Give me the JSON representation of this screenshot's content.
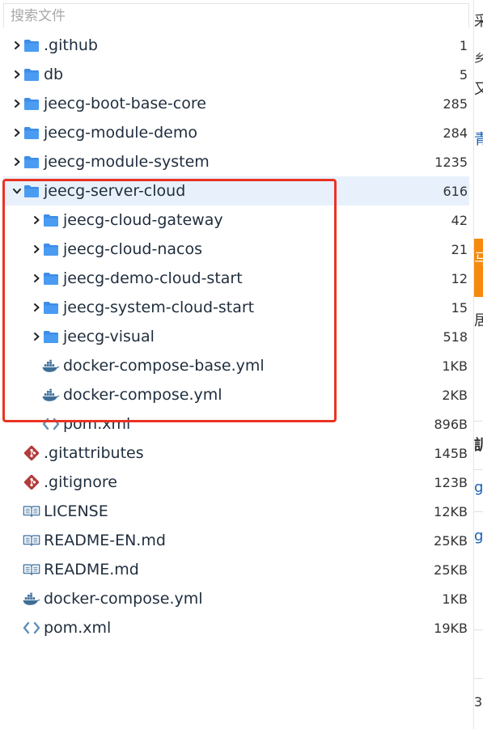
{
  "search": {
    "placeholder": "搜索文件"
  },
  "colors": {
    "folder": "#4a9cf2",
    "git": "#b23b3b",
    "docker": "#3f6f98",
    "xml": "#5f8eb5",
    "book": "#4a7aa8",
    "highlight": "#ea3323",
    "selected_bg": "#e8f1fb"
  },
  "tree": [
    {
      "name": ".github",
      "size": "1",
      "type": "folder",
      "depth": 0,
      "expanded": false
    },
    {
      "name": "db",
      "size": "5",
      "type": "folder",
      "depth": 0,
      "expanded": false
    },
    {
      "name": "jeecg-boot-base-core",
      "size": "285",
      "type": "folder",
      "depth": 0,
      "expanded": false
    },
    {
      "name": "jeecg-module-demo",
      "size": "284",
      "type": "folder",
      "depth": 0,
      "expanded": false
    },
    {
      "name": "jeecg-module-system",
      "size": "1235",
      "type": "folder",
      "depth": 0,
      "expanded": false
    },
    {
      "name": "jeecg-server-cloud",
      "size": "616",
      "type": "folder",
      "depth": 0,
      "expanded": true,
      "selected": true
    },
    {
      "name": "jeecg-cloud-gateway",
      "size": "42",
      "type": "folder",
      "depth": 1,
      "expanded": false
    },
    {
      "name": "jeecg-cloud-nacos",
      "size": "21",
      "type": "folder",
      "depth": 1,
      "expanded": false
    },
    {
      "name": "jeecg-demo-cloud-start",
      "size": "12",
      "type": "folder",
      "depth": 1,
      "expanded": false
    },
    {
      "name": "jeecg-system-cloud-start",
      "size": "15",
      "type": "folder",
      "depth": 1,
      "expanded": false
    },
    {
      "name": "jeecg-visual",
      "size": "518",
      "type": "folder",
      "depth": 1,
      "expanded": false
    },
    {
      "name": "docker-compose-base.yml",
      "size": "1KB",
      "type": "docker",
      "depth": 1
    },
    {
      "name": "docker-compose.yml",
      "size": "2KB",
      "type": "docker",
      "depth": 1
    },
    {
      "name": "pom.xml",
      "size": "896B",
      "type": "xml",
      "depth": 1
    },
    {
      "name": ".gitattributes",
      "size": "145B",
      "type": "git",
      "depth": 0
    },
    {
      "name": ".gitignore",
      "size": "123B",
      "type": "git",
      "depth": 0
    },
    {
      "name": "LICENSE",
      "size": "12KB",
      "type": "book",
      "depth": 0
    },
    {
      "name": "README-EN.md",
      "size": "25KB",
      "type": "book",
      "depth": 0
    },
    {
      "name": "README.md",
      "size": "25KB",
      "type": "book",
      "depth": 0
    },
    {
      "name": "docker-compose.yml",
      "size": "1KB",
      "type": "docker",
      "depth": 0
    },
    {
      "name": "pom.xml",
      "size": "19KB",
      "type": "xml",
      "depth": 0
    }
  ],
  "right_edge": {
    "chars": [
      {
        "text": "采"
      },
      {
        "text": "乡"
      },
      {
        "text": "又"
      },
      {
        "text": "青"
      },
      {
        "text": "马"
      },
      {
        "text": "居"
      },
      {
        "text": "訓"
      },
      {
        "text": "g"
      },
      {
        "text": "g"
      },
      {
        "text": "3"
      }
    ]
  }
}
